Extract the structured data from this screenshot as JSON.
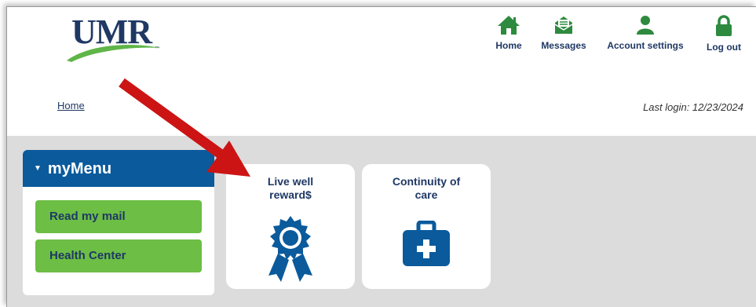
{
  "header": {
    "logo_text": "UMR",
    "logo_tm": "™",
    "nav": [
      {
        "label": "Home",
        "icon": "home-icon"
      },
      {
        "label": "Messages",
        "icon": "envelope-icon"
      },
      {
        "label": "Account settings",
        "icon": "user-icon"
      },
      {
        "label": "Log out",
        "icon": "lock-icon"
      }
    ],
    "breadcrumb": "Home",
    "last_login": "Last login: 12/23/2024"
  },
  "mymenu": {
    "title": "myMenu",
    "items": [
      "Read my mail",
      "Health Center"
    ]
  },
  "tiles": [
    {
      "title": "Live well\nreward$",
      "icon": "award-ribbon-icon"
    },
    {
      "title": "Continuity of\ncare",
      "icon": "medical-kit-icon"
    }
  ],
  "colors": {
    "brand_blue": "#0a5a9c",
    "brand_green": "#2d8a3e",
    "menu_green": "#6cbe45",
    "navy_text": "#1f3864",
    "arrow_red": "#cc1414"
  }
}
